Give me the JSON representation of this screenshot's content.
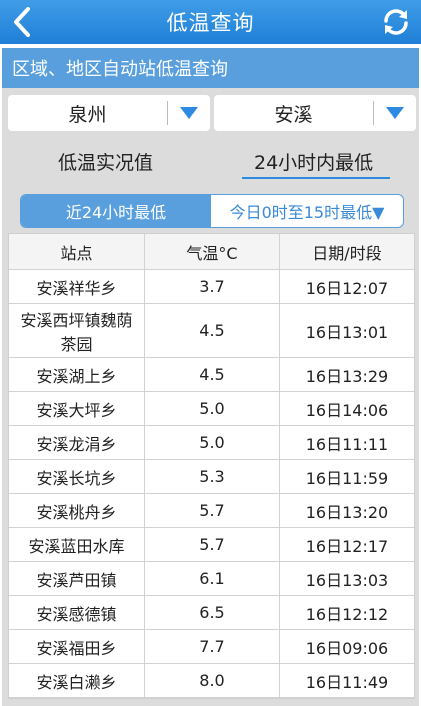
{
  "titlebar": {
    "title": "低温查询",
    "back_icon": "chevron-left-icon",
    "refresh_icon": "refresh-icon"
  },
  "section": {
    "header": "区域、地区自动站低温查询"
  },
  "filters": {
    "city": "泉州",
    "county": "安溪",
    "dropdown_icon": "triangle-down-icon",
    "accent_color": "#2c8ae0"
  },
  "modes": {
    "realtime": "低温实况值",
    "lowest_24h": "24小时内最低",
    "selected": "24小时内最低"
  },
  "tabs": {
    "recent24": "近24小时最低",
    "today": "今日0时至15时最低▼",
    "active": "近24小时最低"
  },
  "table": {
    "headers": [
      "站点",
      "气温°C",
      "日期/时段"
    ],
    "rows": [
      [
        "安溪祥华乡",
        "3.7",
        "16日12:07"
      ],
      [
        "安溪西坪镇魏荫茶园",
        "4.5",
        "16日13:01"
      ],
      [
        "安溪湖上乡",
        "4.5",
        "16日13:29"
      ],
      [
        "安溪大坪乡",
        "5.0",
        "16日14:06"
      ],
      [
        "安溪龙涓乡",
        "5.0",
        "16日11:11"
      ],
      [
        "安溪长坑乡",
        "5.3",
        "16日11:59"
      ],
      [
        "安溪桃舟乡",
        "5.7",
        "16日13:20"
      ],
      [
        "安溪蓝田水库",
        "5.7",
        "16日12:17"
      ],
      [
        "安溪芦田镇",
        "6.1",
        "16日13:03"
      ],
      [
        "安溪感德镇",
        "6.5",
        "16日12:12"
      ],
      [
        "安溪福田乡",
        "7.7",
        "16日09:06"
      ],
      [
        "安溪白濑乡",
        "8.0",
        "16日11:49"
      ]
    ]
  }
}
